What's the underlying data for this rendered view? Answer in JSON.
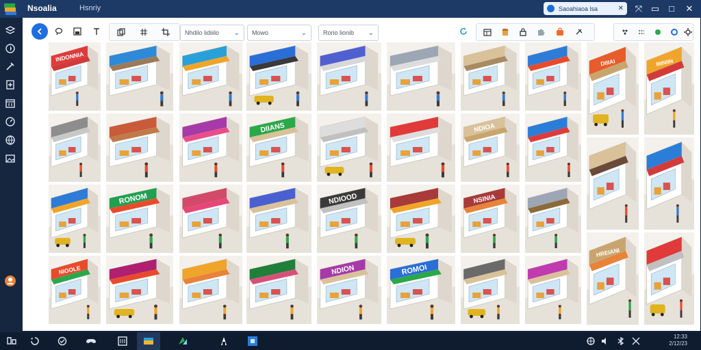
{
  "app": {
    "title": "Nsoalia",
    "menu_label": "Hsnriy",
    "pill_text": "Saoahiaoa lsa"
  },
  "window_controls": [
    "close-x-icon",
    "expand-icon",
    "minimize-icon",
    "maximize-icon",
    "close-icon"
  ],
  "sidebar": {
    "items": [
      {
        "icon": "layers-icon"
      },
      {
        "icon": "compass-icon"
      },
      {
        "icon": "brush-icon"
      },
      {
        "icon": "add-page-icon"
      },
      {
        "icon": "calendar-icon"
      },
      {
        "icon": "gauge-icon"
      },
      {
        "icon": "globe-icon"
      },
      {
        "icon": "image-icon"
      },
      {
        "icon": "user-avatar-icon"
      }
    ]
  },
  "toolbar": {
    "tools_left": [
      "back-arrow-icon",
      "lasso-icon",
      "save-icon",
      "text-icon",
      "copy-icon",
      "grid-icon",
      "crop-icon"
    ],
    "selects": [
      {
        "value": "Nhdilo lidiiilo"
      },
      {
        "value": "Mowo"
      },
      {
        "value": "Rorio lionib"
      }
    ],
    "tools_right": [
      "refresh-icon",
      "table-icon",
      "shop-icon",
      "lock-icon",
      "puzzle-icon",
      "bag-icon",
      "sparkle-icon"
    ],
    "tools_far_right": [
      "palette-icon",
      "dots-grid-icon",
      "leaf-icon",
      "circle-icon",
      "gear-icon"
    ]
  },
  "colors": {
    "titlebar": "#1d3a66",
    "accent": "#1f6ee0",
    "panel": "#ffffff",
    "taskbar": "#0f1c30"
  },
  "tiles": [
    {
      "sign": "INDONNIA",
      "sign_color": "#e03a3a",
      "awning": "#d23b3b"
    },
    {
      "sign": "",
      "sign_color": "#8d8d8d",
      "awning": "#c8c8c8"
    },
    {
      "sign": "",
      "sign_color": "#2e7bd8",
      "awning": "#f0a52a"
    },
    {
      "sign": "NIOOLE",
      "sign_color": "#e84b2c",
      "awning": "#2aa84a"
    },
    {
      "sign": "",
      "sign_color": "#2e8ad8",
      "awning": "#9c7a5a"
    },
    {
      "sign": "",
      "sign_color": "#c95b3a",
      "awning": "#c07a4a"
    },
    {
      "sign": "RONOM",
      "sign_color": "#20a050",
      "awning": "#e84b2c"
    },
    {
      "sign": "",
      "sign_color": "#b02070",
      "awning": "#e84b2c"
    },
    {
      "sign": "",
      "sign_color": "#2aa0d8",
      "awning": "#f0a52a"
    },
    {
      "sign": "",
      "sign_color": "#a63aa8",
      "awning": "#e94e8a"
    },
    {
      "sign": "",
      "sign_color": "#d24a6a",
      "awning": "#e8457a"
    },
    {
      "sign": "",
      "sign_color": "#f0a52a",
      "awning": "#e8833a"
    },
    {
      "sign": "",
      "sign_color": "#2a6ed8",
      "awning": "#3a3a3a"
    },
    {
      "sign": "DIIANS",
      "sign_color": "#2aa84a",
      "awning": "#d9c19a"
    },
    {
      "sign": "",
      "sign_color": "#4a60d0",
      "awning": "#d9c19a"
    },
    {
      "sign": "",
      "sign_color": "#20803a",
      "awning": "#d8507a"
    },
    {
      "sign": "",
      "sign_color": "#5060d0",
      "awning": "#d8d8d8"
    },
    {
      "sign": "",
      "sign_color": "#dddddd",
      "awning": "#c0c0c0"
    },
    {
      "sign": "NDIOOD",
      "sign_color": "#3a3a3a",
      "awning": "#c0c0c0"
    },
    {
      "sign": "NDION",
      "sign_color": "#a63aa8",
      "awning": "#d9c19a"
    },
    {
      "sign": "",
      "sign_color": "#9da6b4",
      "awning": "#dddddd"
    },
    {
      "sign": "",
      "sign_color": "#e03a3a",
      "awning": "#dddddd"
    },
    {
      "sign": "",
      "sign_color": "#a83a3a",
      "awning": "#f0a52a"
    },
    {
      "sign": "ROMOI",
      "sign_color": "#2a6ed8",
      "awning": "#2aa84a"
    },
    {
      "sign": "",
      "sign_color": "#d9c19a",
      "awning": "#a98b63"
    },
    {
      "sign": "NDIOA",
      "sign_color": "#d9c19a",
      "awning": "#c9a56e"
    },
    {
      "sign": "NSINIA",
      "sign_color": "#a83a3a",
      "awning": "#e8833a"
    },
    {
      "sign": "",
      "sign_color": "#6a6a6a",
      "awning": "#d9c19a"
    },
    {
      "sign": "",
      "sign_color": "#2e7bd8",
      "awning": "#e84b2c"
    },
    {
      "sign": "",
      "sign_color": "#2a7ed8",
      "awning": "#e03a3a"
    },
    {
      "sign": "",
      "sign_color": "#9da6b4",
      "awning": "#8b6a3a"
    },
    {
      "sign": "",
      "sign_color": "#c03ab0",
      "awning": "#d9c19a"
    },
    {
      "sign": "DIIIAI",
      "sign_color": "#e85b2a",
      "awning": "#c9a56e"
    },
    {
      "sign": "",
      "sign_color": "#d9c19a",
      "awning": "#6a4a3a"
    },
    {
      "sign": "HREIANI",
      "sign_color": "#c9a56e",
      "awning": "#e8833a"
    },
    {
      "sign": "IIIINIIN",
      "sign_color": "#f0a52a",
      "awning": "#d23b3b"
    },
    {
      "sign": "",
      "sign_color": "#2a7ed8",
      "awning": "#d23b3b"
    },
    {
      "sign": "",
      "sign_color": "#e03a3a",
      "awning": "#c0c0c0"
    }
  ],
  "taskbar": {
    "items": [
      "start-icon",
      "search-icon",
      "task-view-icon",
      "gamepad-icon",
      "files-icon",
      "folder-icon",
      "design-app-icon",
      "store-icon",
      "blue-app-icon"
    ],
    "tray": [
      "network-icon",
      "volume-icon",
      "bluetooth-icon",
      "battery-icon"
    ],
    "clock": "12:33",
    "date": "2/12/23"
  }
}
